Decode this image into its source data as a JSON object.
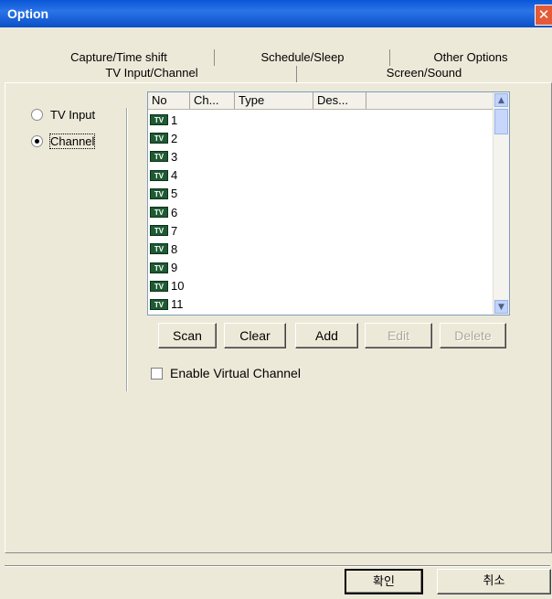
{
  "window": {
    "title": "Option",
    "close_glyph": "✕"
  },
  "tabs": {
    "row1": [
      "Capture/Time shift",
      "Schedule/Sleep",
      "Other Options"
    ],
    "row2": [
      "TV Input/Channel",
      "Screen/Sound"
    ]
  },
  "source": {
    "tv_input_label": "TV Input",
    "channel_label": "Channel",
    "selected": "Channel"
  },
  "list": {
    "columns": [
      "No",
      "Ch...",
      "Type",
      "Des..."
    ],
    "icon": "tv-icon",
    "icon_text": "TV",
    "rows": [
      "1",
      "2",
      "3",
      "4",
      "5",
      "6",
      "7",
      "8",
      "9",
      "10",
      "11"
    ]
  },
  "buttons": {
    "scan": "Scan",
    "clear": "Clear",
    "add": "Add",
    "edit": "Edit",
    "delete": "Delete"
  },
  "options": {
    "enable_virtual_channel": "Enable Virtual Channel",
    "enable_virtual_channel_checked": false
  },
  "footer": {
    "ok": "확인",
    "cancel": "취소"
  }
}
